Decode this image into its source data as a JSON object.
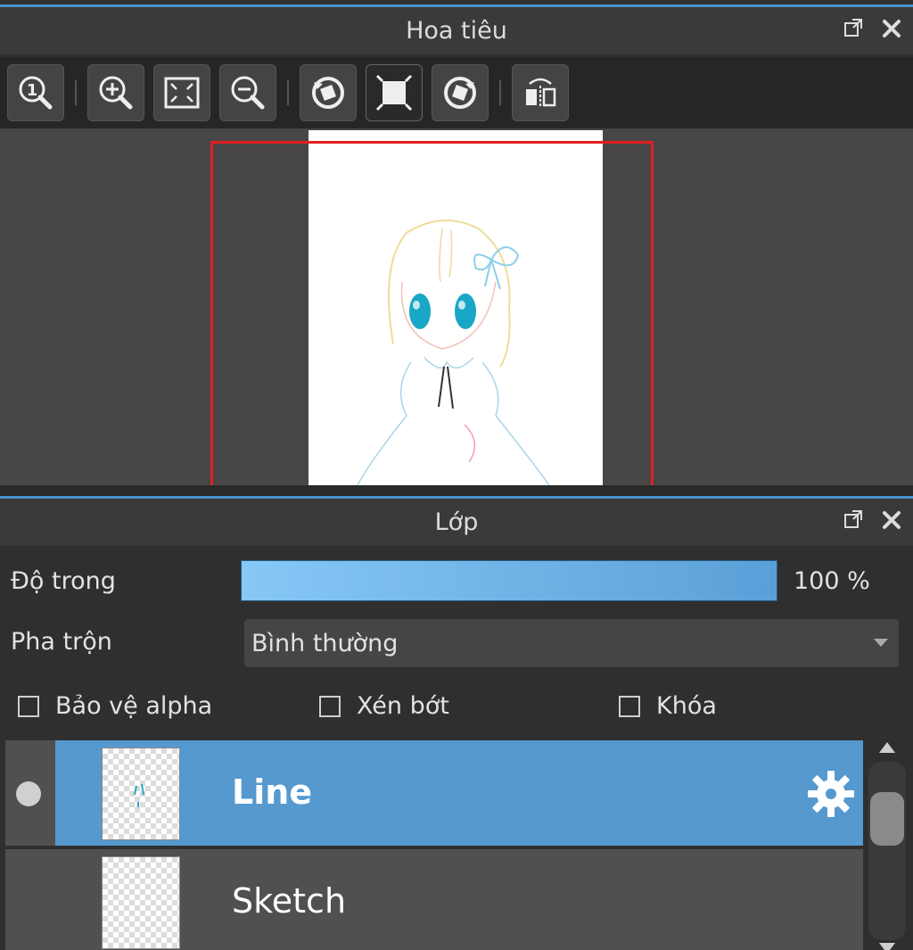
{
  "navigator": {
    "title": "Hoa tiêu",
    "header_icons": [
      "popout-icon",
      "close-icon"
    ],
    "toolbar": [
      {
        "icon": "actual-size-icon"
      },
      {
        "icon": "zoom-in-icon"
      },
      {
        "icon": "fit-screen-icon"
      },
      {
        "icon": "zoom-out-icon"
      },
      {
        "icon": "rotate-left-icon"
      },
      {
        "icon": "reset-rotation-icon"
      },
      {
        "icon": "rotate-right-icon"
      },
      {
        "icon": "flip-horizontal-icon"
      }
    ],
    "view_rect_color": "#e02020"
  },
  "layers": {
    "title": "Lớp",
    "header_icons": [
      "popout-icon",
      "close-icon"
    ],
    "opacity_label": "Độ trong",
    "opacity_value": "100 %",
    "opacity_level": 1.0,
    "blend_label": "Pha trộn",
    "blend_value": "Bình thường",
    "checks": {
      "alpha": "Bảo vệ alpha",
      "clip": "Xén bớt",
      "lock": "Khóa"
    },
    "items": [
      {
        "name": "Line",
        "selected": true
      },
      {
        "name": "Sketch",
        "selected": false
      }
    ],
    "accent_color": "#5599cf"
  }
}
